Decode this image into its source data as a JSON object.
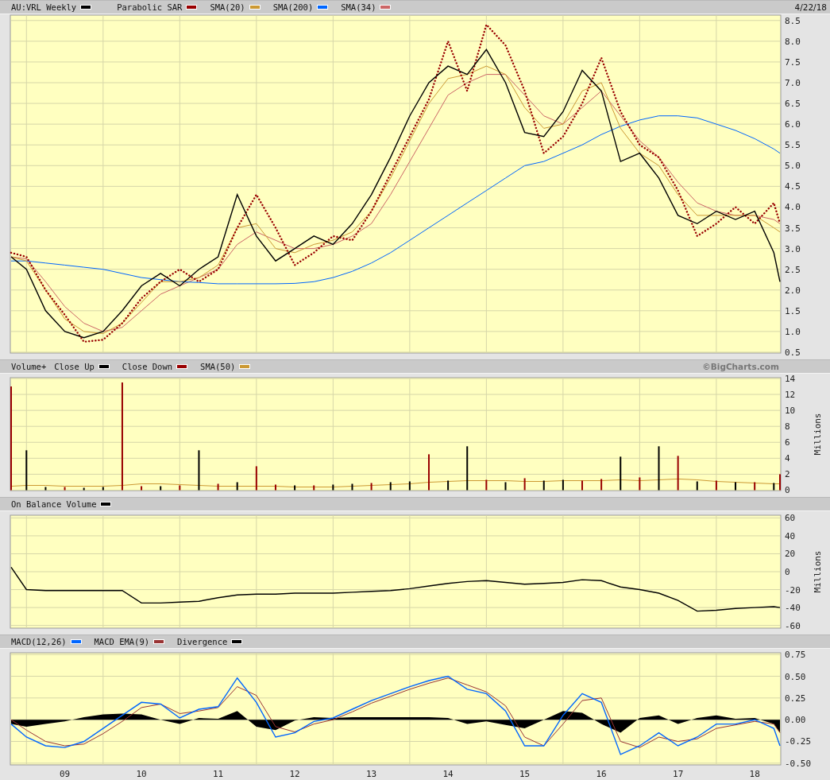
{
  "panels": [
    {
      "date": "4/22/18",
      "chart_data": {
        "type": "line",
        "grid": true,
        "x": [
          2008.3,
          2008.5,
          2008.75,
          2009,
          2009.25,
          2009.5,
          2009.75,
          2010,
          2010.25,
          2010.5,
          2010.75,
          2011,
          2011.25,
          2011.5,
          2011.75,
          2012,
          2012.25,
          2012.5,
          2012.75,
          2013,
          2013.25,
          2013.5,
          2013.75,
          2014,
          2014.25,
          2014.5,
          2014.75,
          2015,
          2015.25,
          2015.5,
          2015.75,
          2016,
          2016.25,
          2016.5,
          2016.75,
          2017,
          2017.25,
          2017.5,
          2017.75,
          2018,
          2018.25,
          2018.33
        ],
        "xlim": [
          2008.3,
          2018.33
        ],
        "ylim": [
          0.48,
          8.63
        ],
        "yticks": [
          {
            "value": 0.5,
            "label": "0.5"
          },
          {
            "value": 1,
            "label": "1.0"
          },
          {
            "value": 1.5,
            "label": "1.5"
          },
          {
            "value": 2,
            "label": "2.0"
          },
          {
            "value": 2.5,
            "label": "2.5"
          },
          {
            "value": 3,
            "label": "3.0"
          },
          {
            "value": 3.5,
            "label": "3.5"
          },
          {
            "value": 4,
            "label": "4.0"
          },
          {
            "value": 4.5,
            "label": "4.5"
          },
          {
            "value": 5,
            "label": "5.0"
          },
          {
            "value": 5.5,
            "label": "5.5"
          },
          {
            "value": 6,
            "label": "6.0"
          },
          {
            "value": 6.5,
            "label": "6.5"
          },
          {
            "value": 7,
            "label": "7.0"
          },
          {
            "value": 7.5,
            "label": "7.5"
          },
          {
            "value": 8,
            "label": "8.0"
          },
          {
            "value": 8.5,
            "label": "8.5"
          }
        ],
        "series": [
          {
            "name": "AU:VRL Weekly",
            "color": "#000000",
            "values": [
              2.8,
              2.5,
              1.5,
              1.0,
              0.85,
              1.0,
              1.5,
              2.1,
              2.4,
              2.1,
              2.5,
              2.8,
              4.3,
              3.3,
              2.7,
              3.0,
              3.3,
              3.1,
              3.6,
              4.3,
              5.2,
              6.2,
              7.0,
              7.4,
              7.2,
              7.8,
              7.0,
              5.8,
              5.7,
              6.3,
              7.3,
              6.8,
              5.1,
              5.3,
              4.7,
              3.8,
              3.6,
              3.9,
              3.7,
              3.9,
              2.9,
              2.2
            ]
          },
          {
            "name": "Parabolic SAR",
            "color": "#990000",
            "line_style": "dotted",
            "values": [
              2.9,
              2.8,
              2.0,
              1.4,
              0.75,
              0.8,
              1.2,
              1.8,
              2.2,
              2.5,
              2.2,
              2.5,
              3.5,
              4.3,
              3.5,
              2.6,
              2.9,
              3.3,
              3.2,
              3.9,
              4.8,
              5.7,
              6.6,
              8.0,
              6.8,
              8.4,
              7.9,
              6.8,
              5.3,
              5.7,
              6.5,
              7.6,
              6.3,
              5.5,
              5.2,
              4.4,
              3.3,
              3.6,
              4.0,
              3.6,
              4.1,
              3.6
            ]
          },
          {
            "name": "SMA(20)",
            "color": "#cc9933",
            "values": [
              2.8,
              2.7,
              2.0,
              1.3,
              1.0,
              0.95,
              1.2,
              1.7,
              2.2,
              2.2,
              2.3,
              2.6,
              3.5,
              3.6,
              3.0,
              2.9,
              3.1,
              3.2,
              3.4,
              3.9,
              4.7,
              5.6,
              6.5,
              7.1,
              7.2,
              7.4,
              7.2,
              6.4,
              5.9,
              6.0,
              6.8,
              7.0,
              5.9,
              5.3,
              5.0,
              4.3,
              3.8,
              3.8,
              3.8,
              3.8,
              3.5,
              3.4
            ]
          },
          {
            "name": "SMA(200)",
            "color": "#0066ff",
            "values": [
              2.7,
              2.7,
              2.65,
              2.6,
              2.55,
              2.5,
              2.4,
              2.3,
              2.25,
              2.2,
              2.18,
              2.15,
              2.15,
              2.15,
              2.15,
              2.16,
              2.2,
              2.3,
              2.45,
              2.65,
              2.9,
              3.2,
              3.5,
              3.8,
              4.1,
              4.4,
              4.7,
              5.0,
              5.1,
              5.3,
              5.5,
              5.75,
              5.95,
              6.1,
              6.2,
              6.2,
              6.15,
              6.0,
              5.85,
              5.65,
              5.4,
              5.3
            ]
          },
          {
            "name": "SMA(34)",
            "color": "#cc6666",
            "values": [
              2.8,
              2.75,
              2.2,
              1.6,
              1.2,
              1.0,
              1.1,
              1.5,
              1.9,
              2.1,
              2.3,
              2.5,
              3.1,
              3.4,
              3.2,
              3.0,
              3.0,
              3.1,
              3.3,
              3.6,
              4.3,
              5.1,
              5.9,
              6.7,
              7.0,
              7.2,
              7.2,
              6.7,
              6.2,
              6.0,
              6.4,
              6.8,
              6.2,
              5.6,
              5.2,
              4.6,
              4.1,
              3.9,
              3.8,
              3.8,
              3.7,
              3.6
            ]
          }
        ]
      }
    },
    {
      "credit": "©BigCharts.com",
      "chart_data": {
        "type": "bar",
        "title": "Volume+",
        "grid": true,
        "ylabel": "Millions",
        "x": [
          2008.3,
          2008.5,
          2008.75,
          2009,
          2009.25,
          2009.5,
          2009.75,
          2010,
          2010.25,
          2010.5,
          2010.75,
          2011,
          2011.25,
          2011.5,
          2011.75,
          2012,
          2012.25,
          2012.5,
          2012.75,
          2013,
          2013.25,
          2013.5,
          2013.75,
          2014,
          2014.25,
          2014.5,
          2014.75,
          2015,
          2015.25,
          2015.5,
          2015.75,
          2016,
          2016.25,
          2016.5,
          2016.75,
          2017,
          2017.25,
          2017.5,
          2017.75,
          2018,
          2018.25,
          2018.33
        ],
        "xlim": [
          2008.3,
          2018.33
        ],
        "ylim": [
          -0.05,
          14.1
        ],
        "yticks": [
          0,
          2,
          4,
          6,
          8,
          10,
          12,
          14
        ],
        "series": [
          {
            "name": "Close Up",
            "color": "#000000",
            "values": [
              null,
              5,
              0.4,
              null,
              0.3,
              0.4,
              null,
              null,
              0.5,
              null,
              5,
              null,
              1.0,
              null,
              null,
              0.6,
              null,
              0.7,
              0.8,
              null,
              1.0,
              1.1,
              null,
              1.2,
              5.5,
              null,
              1.0,
              null,
              1.2,
              1.3,
              null,
              null,
              4.2,
              null,
              5.5,
              null,
              1.1,
              null,
              1.0,
              null,
              0.9,
              null
            ]
          },
          {
            "name": "Close Down",
            "color": "#990000",
            "values": [
              13,
              null,
              null,
              0.4,
              null,
              null,
              13.5,
              0.5,
              null,
              0.6,
              null,
              0.8,
              null,
              3,
              0.7,
              null,
              0.6,
              null,
              null,
              0.9,
              null,
              null,
              4.5,
              null,
              null,
              1.3,
              null,
              1.5,
              null,
              null,
              1.2,
              1.4,
              null,
              1.6,
              null,
              4.3,
              null,
              1.2,
              null,
              1.0,
              null,
              2.0
            ]
          },
          {
            "name": "SMA(50)",
            "type": "line",
            "color": "#cc9933",
            "values": [
              0.5,
              0.6,
              0.6,
              0.5,
              0.5,
              0.5,
              0.6,
              0.8,
              0.8,
              0.7,
              0.6,
              0.5,
              0.5,
              0.5,
              0.5,
              0.4,
              0.4,
              0.4,
              0.5,
              0.6,
              0.7,
              0.8,
              1.0,
              1.1,
              1.2,
              1.2,
              1.2,
              1.1,
              1.1,
              1.2,
              1.2,
              1.2,
              1.3,
              1.2,
              1.3,
              1.4,
              1.3,
              1.1,
              1.0,
              0.9,
              0.8,
              0.8
            ]
          }
        ]
      }
    },
    {
      "chart_data": {
        "type": "line",
        "grid": true,
        "ylabel": "Millions",
        "x": [
          2008.3,
          2008.5,
          2008.75,
          2009,
          2009.25,
          2009.5,
          2009.75,
          2010,
          2010.25,
          2010.5,
          2010.75,
          2011,
          2011.25,
          2011.5,
          2011.75,
          2012,
          2012.25,
          2012.5,
          2012.75,
          2013,
          2013.25,
          2013.5,
          2013.75,
          2014,
          2014.25,
          2014.5,
          2014.75,
          2015,
          2015.25,
          2015.5,
          2015.75,
          2016,
          2016.25,
          2016.5,
          2016.75,
          2017,
          2017.25,
          2017.5,
          2017.75,
          2018,
          2018.25,
          2018.33
        ],
        "xlim": [
          2008.3,
          2018.33
        ],
        "ylim": [
          -63,
          63
        ],
        "yticks": [
          -60,
          -40,
          -20,
          0,
          20,
          40,
          60
        ],
        "series": [
          {
            "name": "On Balance Volume",
            "color": "#000000",
            "values": [
              5,
              -20,
              -21,
              -21,
              -21,
              -21,
              -21,
              -35,
              -35,
              -34,
              -33,
              -29,
              -26,
              -25,
              -25,
              -24,
              -24,
              -24,
              -23,
              -22,
              -21,
              -19,
              -16,
              -13,
              -11,
              -10,
              -12,
              -14,
              -13,
              -12,
              -9,
              -10,
              -17,
              -20,
              -24,
              -32,
              -44,
              -43,
              -41,
              -40,
              -39,
              -40
            ]
          }
        ]
      }
    },
    {
      "chart_data": {
        "type": "line",
        "grid": true,
        "x": [
          2008.3,
          2008.5,
          2008.75,
          2009,
          2009.25,
          2009.5,
          2009.75,
          2010,
          2010.25,
          2010.5,
          2010.75,
          2011,
          2011.25,
          2011.5,
          2011.75,
          2012,
          2012.25,
          2012.5,
          2012.75,
          2013,
          2013.25,
          2013.5,
          2013.75,
          2014,
          2014.25,
          2014.5,
          2014.75,
          2015,
          2015.25,
          2015.5,
          2015.75,
          2016,
          2016.25,
          2016.5,
          2016.75,
          2017,
          2017.25,
          2017.5,
          2017.75,
          2018,
          2018.25,
          2018.33
        ],
        "xlim": [
          2008.3,
          2018.33
        ],
        "ylim": [
          -0.52,
          0.77
        ],
        "xticks": [
          {
            "value": 2009,
            "label": "09"
          },
          {
            "value": 2010,
            "label": "10"
          },
          {
            "value": 2011,
            "label": "11"
          },
          {
            "value": 2012,
            "label": "12"
          },
          {
            "value": 2013,
            "label": "13"
          },
          {
            "value": 2014,
            "label": "14"
          },
          {
            "value": 2015,
            "label": "15"
          },
          {
            "value": 2016,
            "label": "16"
          },
          {
            "value": 2017,
            "label": "17"
          },
          {
            "value": 2018,
            "label": "18"
          }
        ],
        "yticks": [
          {
            "value": -0.5,
            "label": "-0.50"
          },
          {
            "value": -0.25,
            "label": "-0.25"
          },
          {
            "value": 0,
            "label": "0.00"
          },
          {
            "value": 0.25,
            "label": "0.25"
          },
          {
            "value": 0.5,
            "label": "0.50"
          },
          {
            "value": 0.75,
            "label": "0.75"
          }
        ],
        "series": [
          {
            "name": "MACD(12,26)",
            "color": "#0066ff",
            "values": [
              -0.05,
              -0.2,
              -0.3,
              -0.32,
              -0.25,
              -0.1,
              0.05,
              0.2,
              0.18,
              0.02,
              0.12,
              0.15,
              0.48,
              0.2,
              -0.2,
              -0.15,
              -0.02,
              0.02,
              0.12,
              0.22,
              0.3,
              0.38,
              0.45,
              0.5,
              0.35,
              0.3,
              0.1,
              -0.3,
              -0.3,
              0.05,
              0.3,
              0.2,
              -0.4,
              -0.3,
              -0.15,
              -0.3,
              -0.2,
              -0.05,
              -0.05,
              0.0,
              -0.1,
              -0.3
            ]
          },
          {
            "name": "MACD EMA(9)",
            "color": "#993333",
            "values": [
              0.0,
              -0.12,
              -0.25,
              -0.3,
              -0.28,
              -0.16,
              -0.02,
              0.14,
              0.18,
              0.07,
              0.1,
              0.14,
              0.38,
              0.28,
              -0.08,
              -0.14,
              -0.05,
              0.0,
              0.09,
              0.19,
              0.27,
              0.35,
              0.42,
              0.48,
              0.4,
              0.32,
              0.16,
              -0.2,
              -0.3,
              -0.05,
              0.22,
              0.25,
              -0.25,
              -0.32,
              -0.2,
              -0.25,
              -0.22,
              -0.1,
              -0.06,
              -0.02,
              -0.05,
              -0.15
            ]
          },
          {
            "name": "Divergence",
            "type": "area",
            "color": "#000000",
            "values": [
              -0.05,
              -0.08,
              -0.05,
              -0.02,
              0.03,
              0.06,
              0.07,
              0.06,
              0.0,
              -0.05,
              0.02,
              0.01,
              0.1,
              -0.08,
              -0.12,
              -0.01,
              0.03,
              0.02,
              0.03,
              0.03,
              0.03,
              0.03,
              0.03,
              0.02,
              -0.05,
              -0.02,
              -0.06,
              -0.1,
              0.0,
              0.1,
              0.08,
              -0.05,
              -0.15,
              0.02,
              0.05,
              -0.05,
              0.02,
              0.05,
              0.01,
              0.02,
              -0.05,
              -0.15
            ]
          }
        ]
      }
    }
  ]
}
